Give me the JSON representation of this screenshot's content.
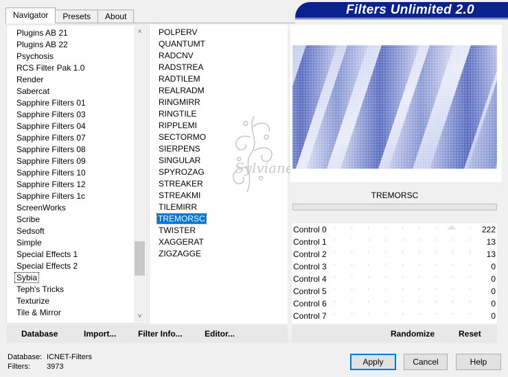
{
  "tabs": [
    "Navigator",
    "Presets",
    "About"
  ],
  "banner_title": "Filters Unlimited 2.0",
  "categories": [
    "Plugins AB 21",
    "Plugins AB 22",
    "Psychosis",
    "RCS Filter Pak 1.0",
    "Render",
    "Sabercat",
    "Sapphire Filters 01",
    "Sapphire Filters 03",
    "Sapphire Filters 04",
    "Sapphire Filters 07",
    "Sapphire Filters 08",
    "Sapphire Filters 09",
    "Sapphire Filters 10",
    "Sapphire Filters 12",
    "Sapphire Filters 1c",
    "ScreenWorks",
    "Scribe",
    "Sedsoft",
    "Simple",
    "Special Effects 1",
    "Special Effects 2",
    "Sybia",
    "Teph's Tricks",
    "Texturize",
    "Tile & Mirror"
  ],
  "focused_category": "Sybia",
  "filters": [
    "POLPERV",
    "QUANTUMT",
    "RADCNV",
    "RADSTREA",
    "RADTILEM",
    "REALRADM",
    "RINGMIRR",
    "RINGTILE",
    "RIPPLEMI",
    "SECTORMO",
    "SIERPENS",
    "SINGULAR",
    "SPYROZAG",
    "STREAKER",
    "STREAKMI",
    "TILEMIRR",
    "TREMORSC",
    "TWISTER",
    "XAGGERAT",
    "ZIGZAGGE"
  ],
  "selected_filter": "TREMORSC",
  "filter_name": "TREMORSC",
  "controls": [
    {
      "label": "Control 0",
      "value": "222",
      "level": 0.87
    },
    {
      "label": "Control 1",
      "value": "13",
      "level": 0.05
    },
    {
      "label": "Control 2",
      "value": "13",
      "level": 0.05
    },
    {
      "label": "Control 3",
      "value": "0",
      "level": 0
    },
    {
      "label": "Control 4",
      "value": "0",
      "level": 0
    },
    {
      "label": "Control 5",
      "value": "0",
      "level": 0
    },
    {
      "label": "Control 6",
      "value": "0",
      "level": 0
    },
    {
      "label": "Control 7",
      "value": "0",
      "level": 0
    }
  ],
  "left_buttons": {
    "database": "Database",
    "import": "Import...",
    "filter_info": "Filter Info...",
    "editor": "Editor..."
  },
  "right_buttons": {
    "randomize": "Randomize",
    "reset": "Reset"
  },
  "status": {
    "database_label": "Database:",
    "database_value": "ICNET-Filters",
    "filters_label": "Filters:",
    "filters_value": "3973"
  },
  "dialog_buttons": {
    "apply": "Apply",
    "cancel": "Cancel",
    "help": "Help"
  },
  "watermark_text": "Sylviane",
  "colors": {
    "banner": "#0a2190",
    "selection": "#0078d7",
    "preview_blue": "#3f55b5"
  }
}
